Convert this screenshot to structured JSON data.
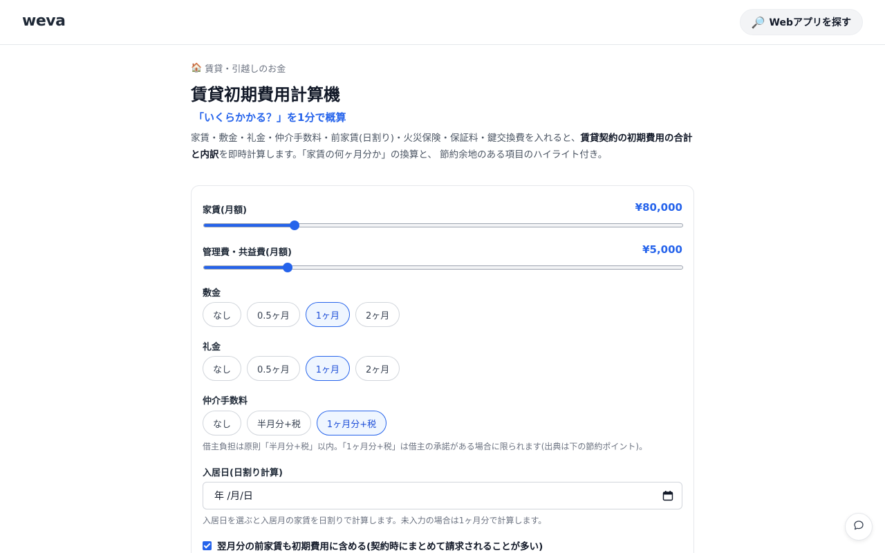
{
  "header": {
    "logo": "weva",
    "explore_button": "Webアプリを探す",
    "explore_icon": "magnifier-icon"
  },
  "page": {
    "category_icon": "house-icon",
    "category": "賃貸・引越しのお金",
    "title": "賃貸初期費用計算機",
    "tagline": "「いくらかかる？」を1分で概算",
    "description_part1": "家賃・敷金・礼金・仲介手数料・前家賃(日割り)・火災保険・保証料・鍵交換費を入れると、",
    "description_bold": "賃貸契約の初期費用の合計と内訳",
    "description_part2": "を即時計算します。「家賃の何ヶ月分か」の換算と、 節約余地のある項目のハイライト付き。"
  },
  "form": {
    "rent": {
      "label": "家賃(月額)",
      "value_text": "¥80,000",
      "fill_fraction": 0.19
    },
    "management_fee": {
      "label": "管理費・共益費(月額)",
      "value_text": "¥5,000",
      "fill_fraction": 0.175
    },
    "deposit": {
      "label": "敷金",
      "options": [
        "なし",
        "0.5ヶ月",
        "1ヶ月",
        "2ヶ月"
      ],
      "selected": "1ヶ月"
    },
    "key_money": {
      "label": "礼金",
      "options": [
        "なし",
        "0.5ヶ月",
        "1ヶ月",
        "2ヶ月"
      ],
      "selected": "1ヶ月"
    },
    "brokerage": {
      "label": "仲介手数料",
      "options": [
        "なし",
        "半月分+税",
        "1ヶ月分+税"
      ],
      "selected": "1ヶ月分+税",
      "note": "借主負担は原則「半月分+税」以内。「1ヶ月分+税」は借主の承諾がある場合に限られます(出典は下の節約ポイント)。"
    },
    "move_in": {
      "label": "入居日(日割り計算)",
      "value": "年 /月/日",
      "note": "入居日を選ぶと入居月の家賃を日割りで計算します。未入力の場合は1ヶ月分で計算します。"
    },
    "next_month_rent": {
      "label": "翌月分の前家賃も初期費用に含める(契約時にまとめて請求されることが多い)",
      "checked": true
    }
  },
  "colors": {
    "accent": "#2563eb",
    "accent_bg": "#eff6ff"
  }
}
